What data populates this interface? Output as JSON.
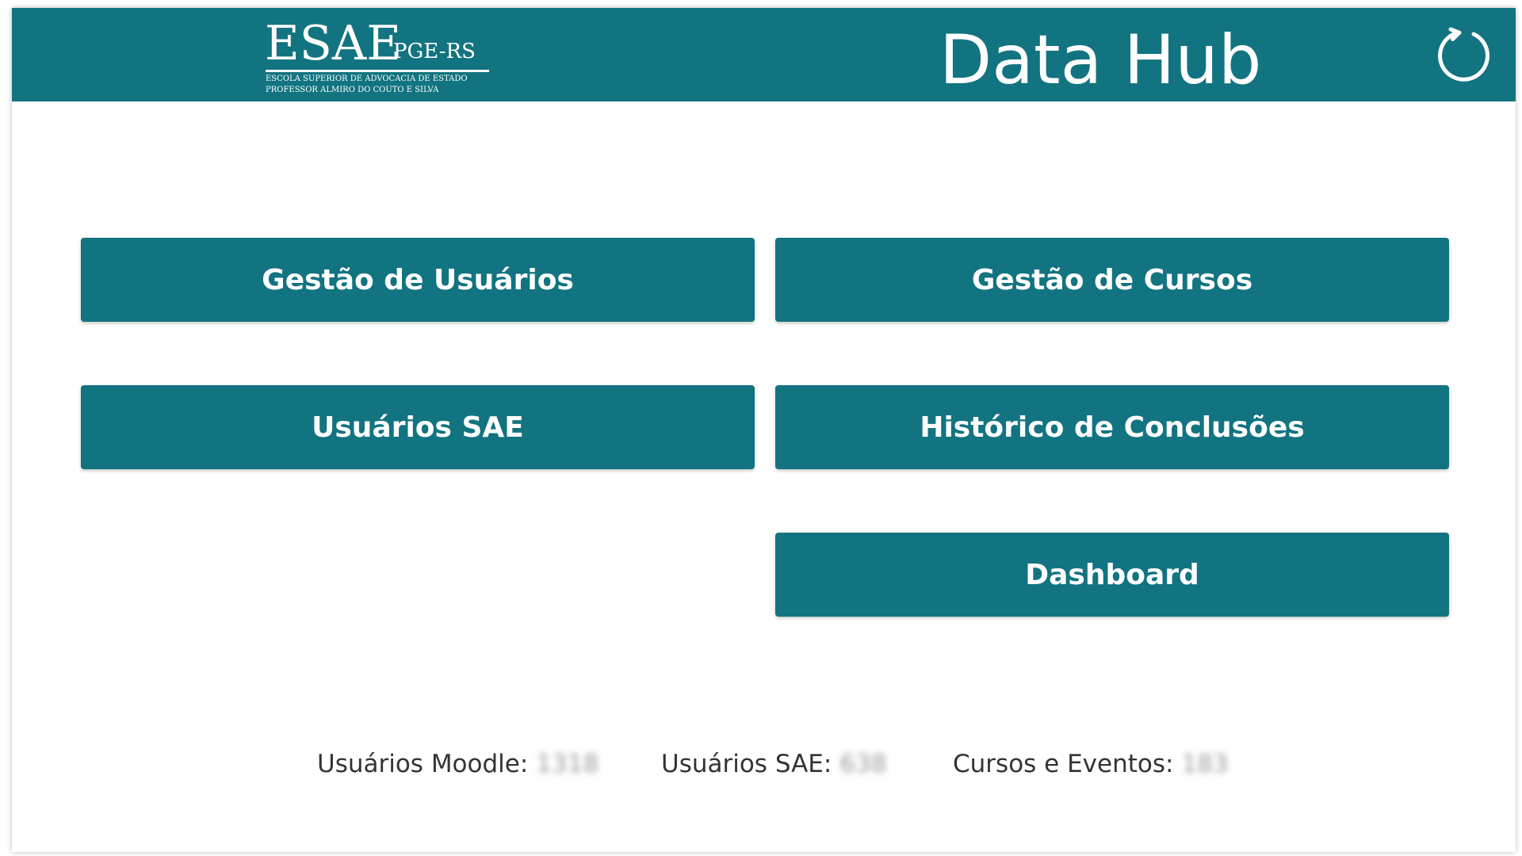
{
  "colors": {
    "accent": "#127480",
    "background": "#ffffff",
    "header_text": "#ffffff",
    "stats_text": "#333333"
  },
  "header": {
    "logo": {
      "main": "ESAE",
      "suffix": "PGE-RS",
      "line1": "ESCOLA SUPERIOR DE ADVOCACIA DE ESTADO",
      "line2": "PROFESSOR ALMIRO DO COUTO E SILVA"
    },
    "title": "Data Hub",
    "refresh_icon": "refresh-icon"
  },
  "buttons": {
    "gestao_usuarios": "Gestão de Usuários",
    "gestao_cursos": "Gestão de Cursos",
    "usuarios_sae": "Usuários SAE",
    "historico_conclusoes": "Histórico de Conclusões",
    "dashboard": "Dashboard"
  },
  "stats": [
    {
      "label": "Usuários Moodle:",
      "value": "1318"
    },
    {
      "label": "Usuários SAE:",
      "value": "638"
    },
    {
      "label": "Cursos e Eventos:",
      "value": "183"
    }
  ]
}
